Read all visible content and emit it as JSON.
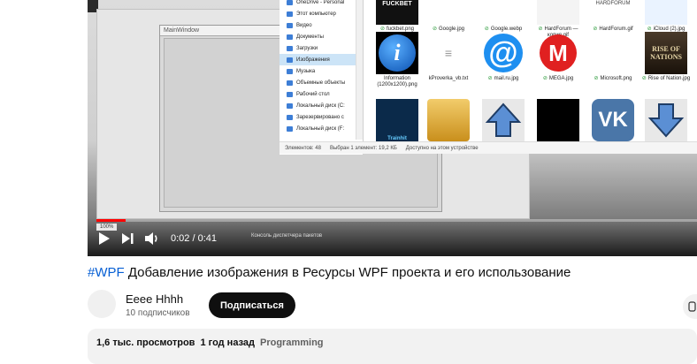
{
  "video": {
    "mainwindow_title": "MainWindow",
    "explorer_items": [
      {
        "label": "OneDrive - Personal",
        "selected": false
      },
      {
        "label": "Этот компьютер",
        "selected": false
      },
      {
        "label": "Видео",
        "selected": false
      },
      {
        "label": "Документы",
        "selected": false
      },
      {
        "label": "Загрузки",
        "selected": false
      },
      {
        "label": "Изображения",
        "selected": true
      },
      {
        "label": "Музыка",
        "selected": false
      },
      {
        "label": "Объемные объекты",
        "selected": false
      },
      {
        "label": "Рабочий стол",
        "selected": false
      },
      {
        "label": "Локальный диск (C:",
        "selected": false
      },
      {
        "label": "Зарезервировано с",
        "selected": false
      },
      {
        "label": "Локальный диск (F:",
        "selected": false
      }
    ],
    "statusbar": {
      "count": "Элементов: 48",
      "selected": "Выбран 1 элемент: 19,2 КБ",
      "available": "Доступно на этом устройстве"
    },
    "files_top_row": [
      "fuckbet.png",
      "Google.jpg",
      "Google.webp",
      "HardForum — копия.gif",
      "HardForum.gif",
      "iCloud (2).jpg"
    ],
    "top_row_thumb_text": [
      "FUCKBET",
      "",
      "",
      "",
      "HARDFORUM",
      ""
    ],
    "files_mid_row": [
      "Information (1200x1200).png",
      "kProverka_vb.txt",
      "mail.ru.jpg",
      "MEGA.jpg",
      "Microsoft.png",
      "Rise of Nation.jpg"
    ],
    "mid_row_thumb_text": [
      "i",
      "",
      "@",
      "M",
      "",
      "RISE OF NATIONS"
    ],
    "bottom_row_thumb_text": [
      "Trainhit",
      "",
      "",
      "",
      "VK",
      ""
    ],
    "toolbar_zoom": "100%",
    "bottom_overlay": "Консоль диспетчера пакетов",
    "progress": 0.049,
    "time": "0:02 / 0:41"
  },
  "title": {
    "hashtag": "#WPF",
    "text": " Добавление изображения в Ресурсы WPF проекта и его использование"
  },
  "channel": {
    "name": "Eeee Hhhh",
    "subscribers": "10 подписчиков",
    "subscribe_label": "Подписаться"
  },
  "description": {
    "views": "1,6 тыс. просмотров",
    "date": "1 год назад",
    "category": "Programming"
  },
  "colors": {
    "link": "#065fd4",
    "progress": "#ff0000",
    "button_bg": "#0f0f0f"
  }
}
